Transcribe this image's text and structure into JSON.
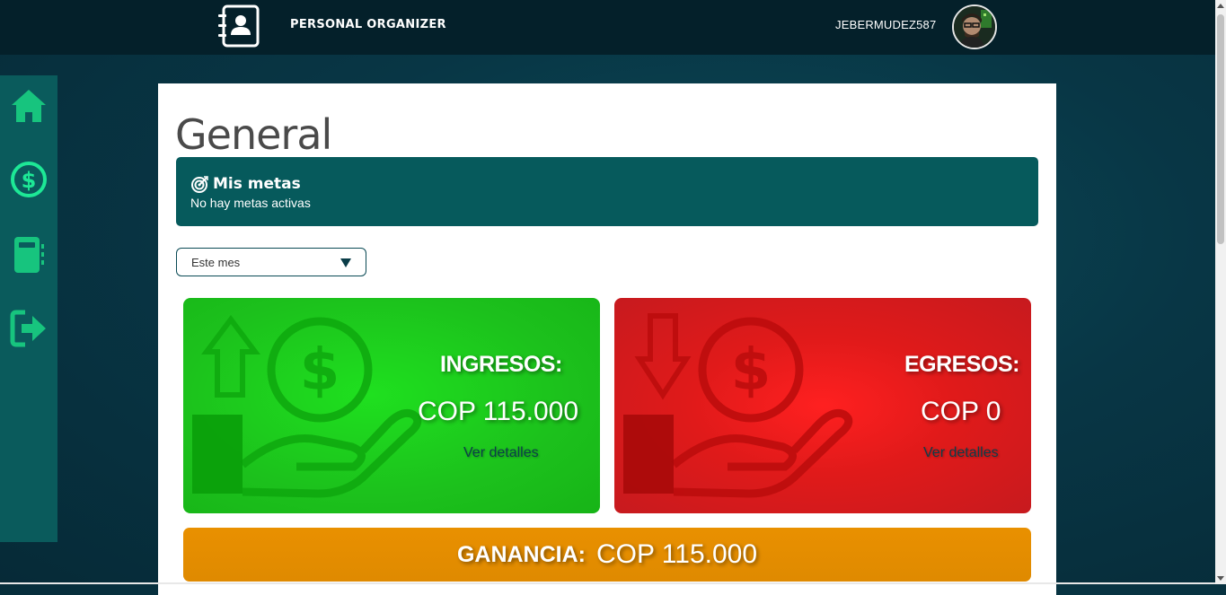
{
  "header": {
    "app_title": "PERSONAL ORGANIZER",
    "username": "JEBERMUDEZ587",
    "icons": {
      "app": "contact-book-icon",
      "avatar": "user-avatar"
    }
  },
  "sidebar": {
    "items": [
      {
        "name": "home",
        "icon": "home-icon"
      },
      {
        "name": "finances",
        "icon": "dollar-circle-icon",
        "active": true
      },
      {
        "name": "notebook",
        "icon": "notebook-icon"
      },
      {
        "name": "logout",
        "icon": "logout-icon"
      }
    ]
  },
  "main": {
    "title": "General",
    "goals": {
      "title": "Mis metas",
      "empty_text": "No hay metas activas",
      "icon": "target-icon"
    },
    "period": {
      "selected": "Este mes"
    },
    "income": {
      "label": "INGRESOS:",
      "amount": "COP 115.000",
      "link": "Ver detalles",
      "color": "#1cc11c"
    },
    "expense": {
      "label": "EGRESOS:",
      "amount": "COP 0",
      "link": "Ver detalles",
      "color": "#e01a1a"
    },
    "profit": {
      "label": "GANANCIA:",
      "amount": "COP 115.000",
      "color": "#e99000"
    }
  },
  "colors": {
    "topbar": "#04202a",
    "sidebar": "#0a5b5c",
    "accent": "#1bdc8c",
    "goals_bg": "#065a5c"
  }
}
